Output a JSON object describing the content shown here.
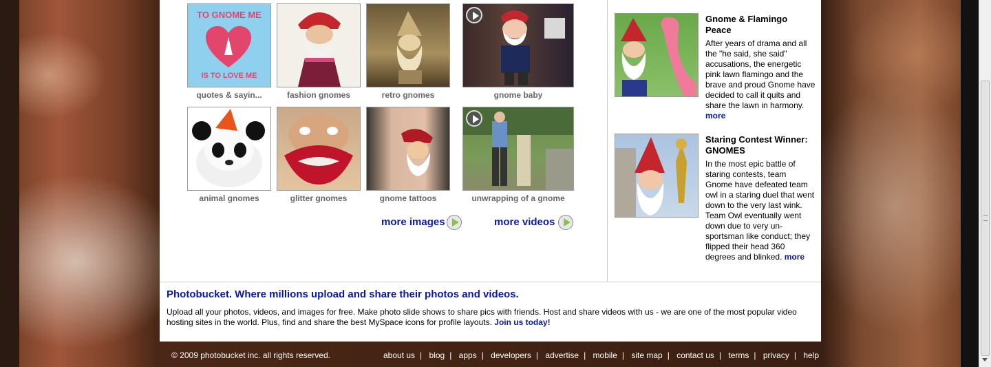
{
  "gallery": {
    "items": [
      {
        "caption": "quotes & sayin...",
        "image_text_top": "TO GNOME ME",
        "image_text_bottom": "IS TO LOVE ME",
        "video": false
      },
      {
        "caption": "fashion gnomes",
        "video": false
      },
      {
        "caption": "retro gnomes",
        "video": false
      },
      {
        "caption": "gnome baby",
        "video": true
      },
      {
        "caption": "animal gnomes",
        "video": false
      },
      {
        "caption": "glitter gnomes",
        "video": false
      },
      {
        "caption": "gnome tattoos",
        "video": false
      },
      {
        "caption": "unwrapping of a gnome",
        "video": true
      }
    ],
    "more_images": "more images",
    "more_videos": "more videos"
  },
  "stories": [
    {
      "title": "Gnome & Flamingo Peace",
      "body": "After years of drama and all the \"he said, she said\" accusations, the energetic pink lawn flamingo and the brave and proud Gnome have decided to call it quits and share the lawn in harmony.",
      "more": "more"
    },
    {
      "title": "Staring Contest Winner: GNOMES",
      "body": "In the most epic battle of staring contests, team Gnome have defeated team owl in a staring duel that went down to the very last wink. Team Owl eventually went down due to very un-sportsman like conduct; they flipped their head 360 degrees and blinked.",
      "more": "more"
    }
  ],
  "promo": {
    "title": "Photobucket. Where millions upload and share their photos and videos.",
    "body": "Upload all your photos, videos, and images for free. Make photo slide shows to share pics with friends. Host and share videos with us - we are one of the most popular video hosting sites in the world. Plus, find and share the best MySpace icons for profile layouts.",
    "join": "Join us today!"
  },
  "footer": {
    "copyright": "© 2009 photobucket inc. all rights reserved.",
    "links": [
      "about us",
      "blog",
      "apps",
      "developers",
      "advertise",
      "mobile",
      "site map",
      "contact us",
      "terms",
      "privacy",
      "help"
    ]
  },
  "colors": {
    "link": "#0a1aa0",
    "caption": "#666666",
    "panel": "#ffffff"
  }
}
